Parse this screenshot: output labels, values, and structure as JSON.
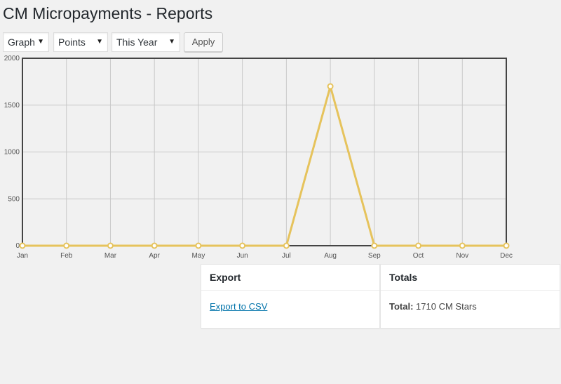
{
  "page": {
    "title": "CM Micropayments - Reports"
  },
  "filters": {
    "view": {
      "value": "Graph"
    },
    "metric": {
      "value": "Points"
    },
    "range": {
      "value": "This Year"
    },
    "apply_label": "Apply"
  },
  "chart_data": {
    "type": "line",
    "categories": [
      "Jan",
      "Feb",
      "Mar",
      "Apr",
      "May",
      "Jun",
      "Jul",
      "Aug",
      "Sep",
      "Oct",
      "Nov",
      "Dec"
    ],
    "series": [
      {
        "values": [
          0,
          0,
          0,
          0,
          0,
          0,
          0,
          1700,
          0,
          0,
          0,
          0
        ],
        "color": "#e6c35c"
      }
    ],
    "ylim": [
      0,
      2000
    ],
    "yticks": [
      0,
      500,
      1000,
      1500,
      2000
    ],
    "grid": true,
    "title": "",
    "xlabel": "",
    "ylabel": ""
  },
  "export_panel": {
    "heading": "Export",
    "link_label": "Export to CSV"
  },
  "totals_panel": {
    "heading": "Totals",
    "label": "Total:",
    "value": "1710 CM Stars"
  }
}
